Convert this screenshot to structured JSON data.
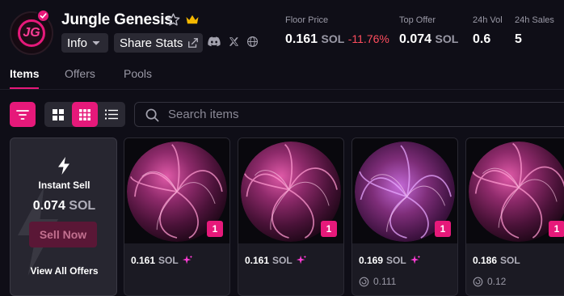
{
  "collection": {
    "name": "Jungle Genesis",
    "logo_text": "JG",
    "info_label": "Info",
    "share_label": "Share Stats"
  },
  "stats": {
    "floor_label": "Floor Price",
    "floor_value": "0.161",
    "floor_unit": "SOL",
    "floor_change": "-11.76%",
    "top_offer_label": "Top Offer",
    "top_offer_value": "0.074",
    "top_offer_unit": "SOL",
    "vol_label": "24h Vol",
    "vol_value": "0.6",
    "sales_label": "24h Sales",
    "sales_value": "5"
  },
  "tabs": [
    {
      "label": "Items"
    },
    {
      "label": "Offers"
    },
    {
      "label": "Pools"
    }
  ],
  "search": {
    "placeholder": "Search items"
  },
  "instant_sell": {
    "title": "Instant Sell",
    "price": "0.074",
    "unit": "SOL",
    "button_label": "Sell Now",
    "view_offers_label": "View All Offers"
  },
  "items": [
    {
      "qty": "1",
      "price": "0.161",
      "unit": "SOL",
      "offer": ""
    },
    {
      "qty": "1",
      "price": "0.161",
      "unit": "SOL",
      "offer": ""
    },
    {
      "qty": "1",
      "price": "0.169",
      "unit": "SOL",
      "offer": "0.111"
    },
    {
      "qty": "1",
      "price": "0.186",
      "unit": "SOL",
      "offer": "0.12"
    }
  ],
  "colors": {
    "accent": "#e6197a",
    "negative": "#ff4d5e",
    "background": "#0f0e17"
  }
}
